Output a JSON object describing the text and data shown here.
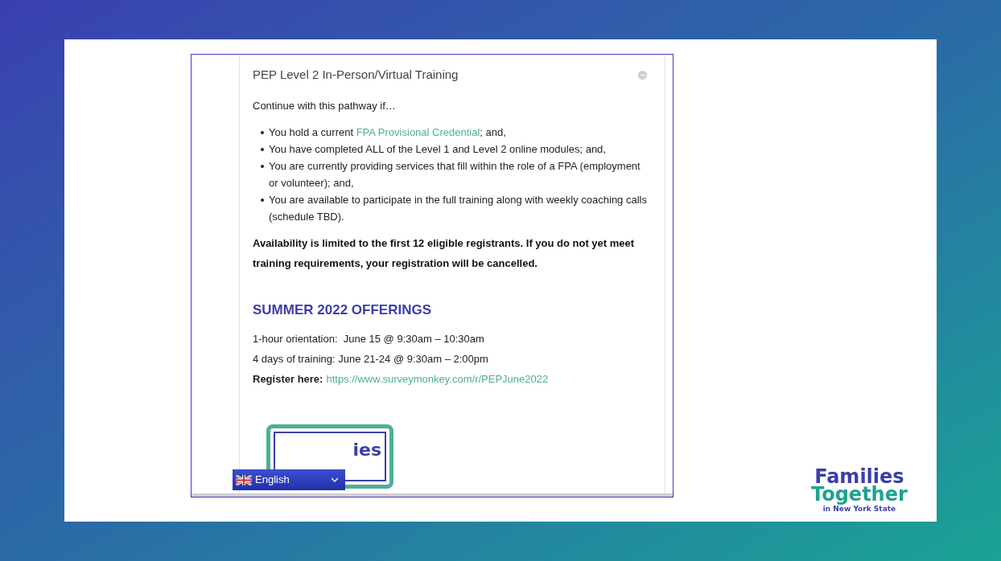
{
  "embedded_page": {
    "accordion_title": "PEP Level 2 In-Person/Virtual Training",
    "intro": "Continue with this pathway if…",
    "bullets": [
      {
        "text": "You hold a current ",
        "link": "FPA Provisional Credential",
        "after": "; and,"
      },
      {
        "text": "You have completed ALL of the Level 1 and Level 2 online modules; and,"
      },
      {
        "text": "You are currently providing services that fill within the role of a FPA (employment or volunteer); and,"
      },
      {
        "text": "You are available to participate in the full training along with weekly coaching calls (schedule TBD)."
      }
    ],
    "notice": "Availability is limited to the first 12 eligible registrants. If you do not yet meet training requirements, your registration will be cancelled.",
    "section_heading": "SUMMER 2022 OFFERINGS",
    "schedule": [
      "1-hour orientation:  June 15 @ 9:30am – 10:30am",
      "4 days of training: June 21-24 @ 9:30am – 2:00pm"
    ],
    "register": {
      "label": "Register here:",
      "url": "https://www.surveymonkey.com/r/PEPJune2022"
    },
    "logo_fragment": "ies",
    "language_selector": {
      "label": "English"
    }
  },
  "slide_logo": {
    "line_1": "Families",
    "line_2": "Together",
    "line_3": "in New York State"
  }
}
